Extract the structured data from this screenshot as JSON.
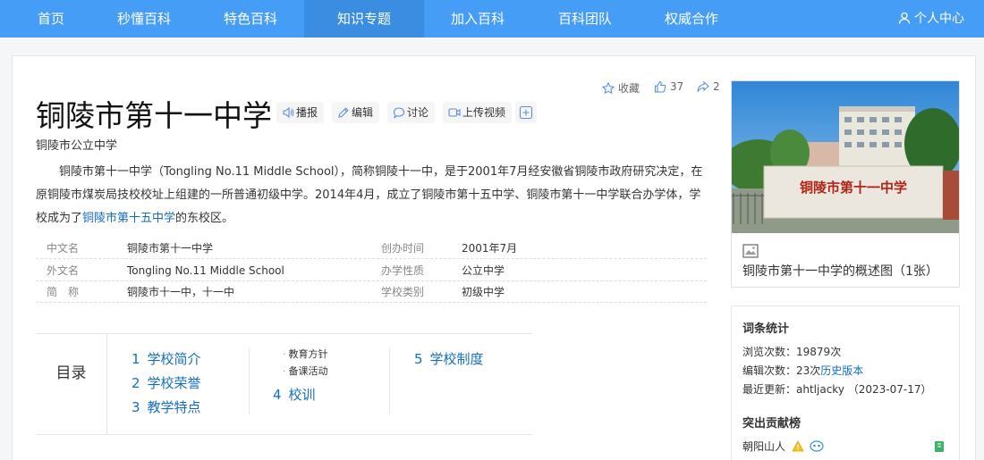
{
  "nav": {
    "items": [
      "首页",
      "秒懂百科",
      "特色百科",
      "知识专题",
      "加入百科",
      "百科团队",
      "权威合作"
    ],
    "user": "个人中心"
  },
  "page": {
    "title": "铜陵市第十一中学",
    "subtitle": "铜陵市公立中学",
    "actions": {
      "speak": "播报",
      "edit": "编辑",
      "discuss": "讨论",
      "video": "上传视频"
    },
    "stats": {
      "favorite": "收藏",
      "likes": "37",
      "shares": "2"
    },
    "summary_parts": {
      "line": "铜陵市第十一中学（Tongling No.11 Middle School），简称铜陵十一中，是于2001年7月经安徽省铜陵市政府研究决定，在原铜陵市煤炭局技校校址上组建的一所普通初级中学。2014年4月，成立了铜陵市第十五中学、铜陵市第十一中学联合办学体，学校成为了",
      "link": "铜陵市第十五中学",
      "tail": "的东校区。"
    }
  },
  "info": [
    {
      "l1": "中文名",
      "v1": "铜陵市第十一中学",
      "l2": "创办时间",
      "v2": "2001年7月"
    },
    {
      "l1": "外文名",
      "v1": "Tongling No.11 Middle School",
      "l2": "办学性质",
      "v2": "公立中学"
    },
    {
      "l1": "简　称",
      "v1": "铜陵市十一中，十一中",
      "l2": "学校类别",
      "v2": "初级中学"
    }
  ],
  "toc": {
    "heading": "目录",
    "items": [
      {
        "num": "1",
        "label": "学校简介"
      },
      {
        "num": "2",
        "label": "学校荣誉"
      },
      {
        "num": "3",
        "label": "教学特点"
      },
      {
        "num": "4",
        "label": "校训"
      },
      {
        "num": "5",
        "label": "学校制度"
      }
    ],
    "subitems": [
      "教育方针",
      "备课活动"
    ]
  },
  "sidebar": {
    "image_caption": "铜陵市第十一中学的概述图（1张）",
    "sign_text": "铜陵市第十一中学",
    "stats_title": "词条统计",
    "views_label": "浏览次数：",
    "views": "19879次",
    "edits_label": "编辑次数：",
    "edits": "23次",
    "history": "历史版本",
    "updated_label": "最近更新：",
    "updated": "ahtljacky （2023-07-17）",
    "contrib_title": "突出贡献榜",
    "contributor": "朝阳山人"
  },
  "colors": {
    "nav_bg": "#459df5",
    "link": "#136ec2"
  }
}
